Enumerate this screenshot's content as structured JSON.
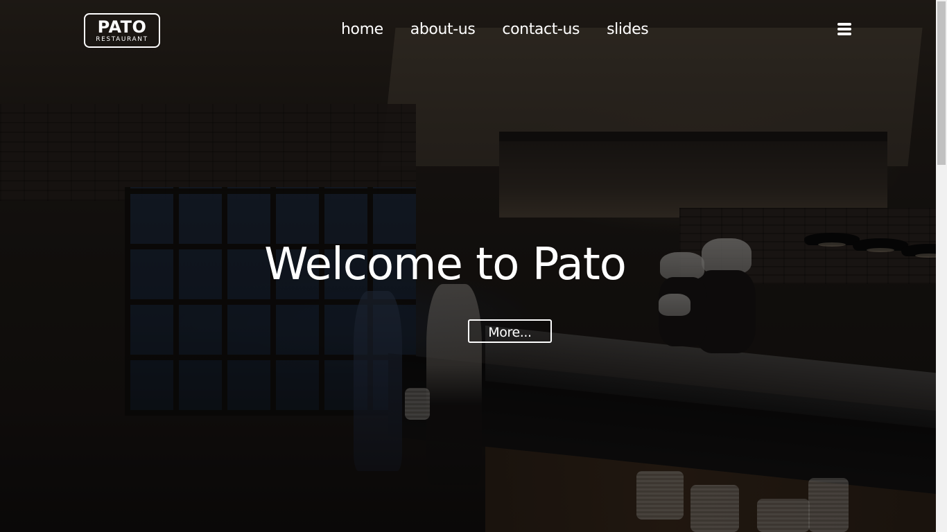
{
  "brand": {
    "logo_main": "PATO",
    "logo_sub": "RESTAURANT"
  },
  "nav": {
    "items": [
      {
        "label": "home"
      },
      {
        "label": "about-us"
      },
      {
        "label": "contact-us"
      },
      {
        "label": "slides"
      }
    ],
    "menu_icon": "hamburger-menu-icon"
  },
  "hero": {
    "title": "Welcome to Pato",
    "button_label": "More..."
  },
  "colors": {
    "text": "#ffffff",
    "overlay": "rgba(0,0,0,0.5)",
    "scrollbar_track": "#f1f1f1",
    "scrollbar_thumb": "#c1c1c1"
  }
}
